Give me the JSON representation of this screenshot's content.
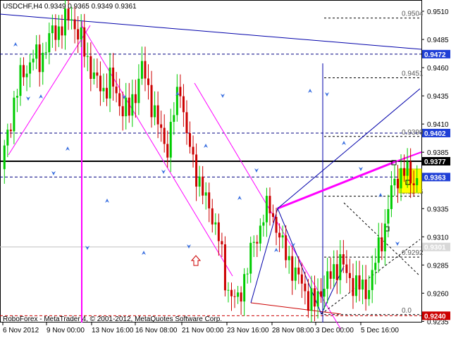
{
  "window": {
    "symbol_header": "USDCHF,H4  0.9349 0.9365 0.9349 0.9361",
    "footer_credit": "RoboForex - MetaTrader 4, © 2001-2012, MetaQuotes Software Corp."
  },
  "colors": {
    "background": "#ffffff",
    "bull_candle": "#00cc00",
    "bear_candle": "#cc0000",
    "grid": "#000000",
    "magenta": "#ff00ff",
    "arrows": "#3a6fe0",
    "blue_lines": "#0000aa",
    "price_label_bg": "#1f3fd6",
    "current_price_bg": "#000000",
    "yellow_box": "#ffff00"
  },
  "price_axis": {
    "min": 0.9234,
    "max": 0.952,
    "ticks": [
      "0.9510",
      "0.9485",
      "0.9460",
      "0.9435",
      "0.9410",
      "0.9385",
      "0.9335",
      "0.9310",
      "0.9285",
      "0.9260",
      "0.9235"
    ],
    "tick_values": [
      0.951,
      0.9485,
      0.946,
      0.9435,
      0.941,
      0.9385,
      0.9335,
      0.931,
      0.9285,
      0.926,
      0.9235
    ],
    "labels": [
      {
        "text": "0.9472",
        "value": 0.9472,
        "style": "blue"
      },
      {
        "text": "0.9402",
        "value": 0.9402,
        "style": "blue"
      },
      {
        "text": "0.9377",
        "value": 0.9377,
        "style": "black"
      },
      {
        "text": "0.9363",
        "value": 0.9363,
        "style": "blue"
      },
      {
        "text": "0.9301",
        "value": 0.9301,
        "style": "gray"
      },
      {
        "text": "0.9240",
        "value": 0.924,
        "style": "red"
      }
    ]
  },
  "time_axis": {
    "labels": [
      "6 Nov 2012",
      "9 Nov 00:00",
      "13 Nov 16:00",
      "16 Nov 08:00",
      "21 Nov 00:00",
      "23 Nov 16:00",
      "28 Nov 08:00",
      "3 Dec 00:00",
      "5 Dec 16:00"
    ]
  },
  "fibo_levels": [
    {
      "text": "0.9504",
      "value": 0.9504
    },
    {
      "text": "0.9451",
      "value": 0.9451
    },
    {
      "text": "0.9399",
      "value": 0.9399
    },
    {
      "text": "0.9346",
      "value": 0.9346
    },
    {
      "text": "0.9292",
      "value": 0.9292
    },
    {
      "text": "0.0",
      "value": 0.9241
    }
  ],
  "chart_data": {
    "type": "candlestick",
    "title": "USDCHF,H4",
    "ohlc_last": {
      "open": 0.9349,
      "high": 0.9365,
      "low": 0.9349,
      "close": 0.9361
    },
    "horizontal_lines": [
      0.9472,
      0.9402,
      0.9377,
      0.9363,
      0.9301,
      0.924
    ],
    "close_path": [
      0.937,
      0.94,
      0.943,
      0.945,
      0.946,
      0.947,
      0.9465,
      0.948,
      0.949,
      0.9495,
      0.95,
      0.9505,
      0.949,
      0.9475,
      0.946,
      0.9445,
      0.944,
      0.945,
      0.9435,
      0.9425,
      0.942,
      0.944,
      0.946,
      0.944,
      0.942,
      0.94,
      0.939,
      0.942,
      0.9445,
      0.94,
      0.9375,
      0.936,
      0.934,
      0.933,
      0.931,
      0.927,
      0.926,
      0.925,
      0.9275,
      0.9295,
      0.931,
      0.933,
      0.9335,
      0.932,
      0.93,
      0.929,
      0.9275,
      0.927,
      0.9255,
      0.925,
      0.9265,
      0.927,
      0.928,
      0.929,
      0.9275,
      0.927,
      0.9265,
      0.9262,
      0.9275,
      0.93,
      0.932,
      0.935,
      0.9365,
      0.9368,
      0.9362,
      0.9361
    ]
  }
}
